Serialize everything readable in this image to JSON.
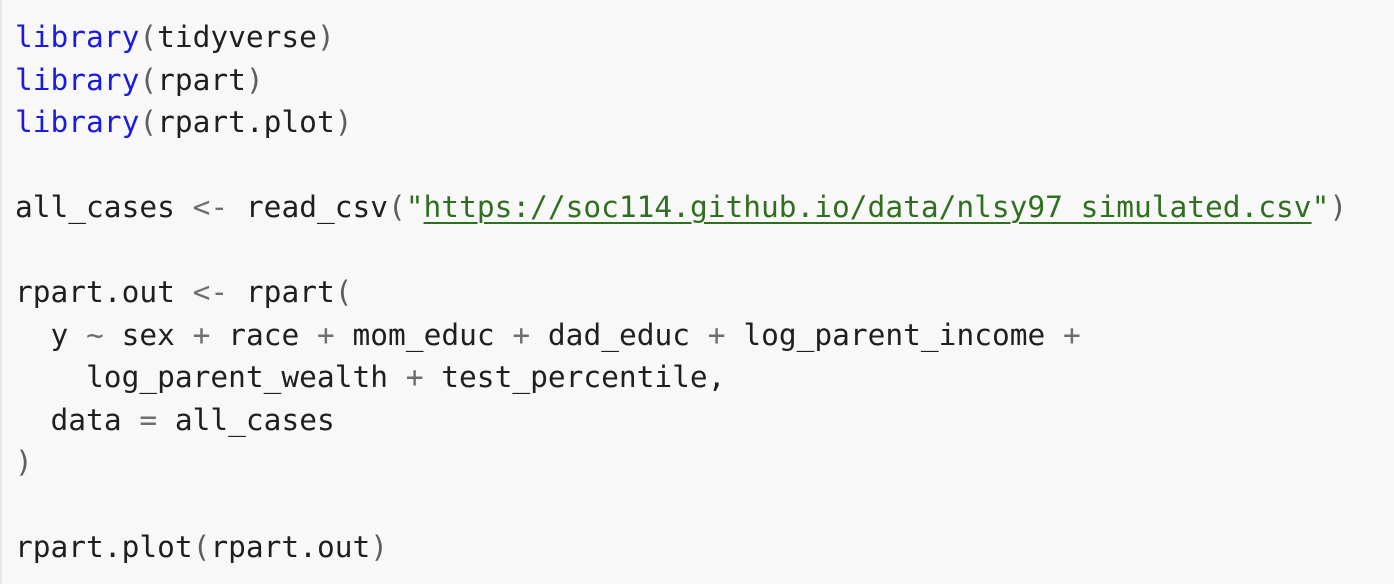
{
  "code": {
    "line1": {
      "fn": "library",
      "open": "(",
      "arg": "tidyverse",
      "close": ")"
    },
    "line2": {
      "fn": "library",
      "open": "(",
      "arg": "rpart",
      "close": ")"
    },
    "line3": {
      "fn": "library",
      "open": "(",
      "arg": "rpart.plot",
      "close": ")"
    },
    "line5": {
      "var": "all_cases",
      "assign": "<-",
      "fn": "read_csv",
      "open": "(",
      "quote_open": "\"",
      "url": "https://soc114.github.io/data/nlsy97_simulated.csv",
      "quote_close": "\"",
      "close": ")"
    },
    "line7": {
      "var": "rpart.out",
      "assign": "<-",
      "fn": "rpart",
      "open": "("
    },
    "line8": {
      "indent": "  ",
      "y": "y",
      "tilde": "~",
      "v1": "sex",
      "plus1": "+",
      "v2": "race",
      "plus2": "+",
      "v3": "mom_educ",
      "plus3": "+",
      "v4": "dad_educ",
      "plus4": "+",
      "v5": "log_parent_income",
      "plus5": "+"
    },
    "line9": {
      "indent": "    ",
      "v6": "log_parent_wealth",
      "plus6": "+",
      "v7": "test_percentile",
      "comma": ","
    },
    "line10": {
      "indent": "  ",
      "arg": "data",
      "eq": "=",
      "val": "all_cases"
    },
    "line11": {
      "close": ")"
    },
    "line13": {
      "fn": "rpart.plot",
      "open": "(",
      "arg": "rpart.out",
      "close": ")"
    }
  }
}
